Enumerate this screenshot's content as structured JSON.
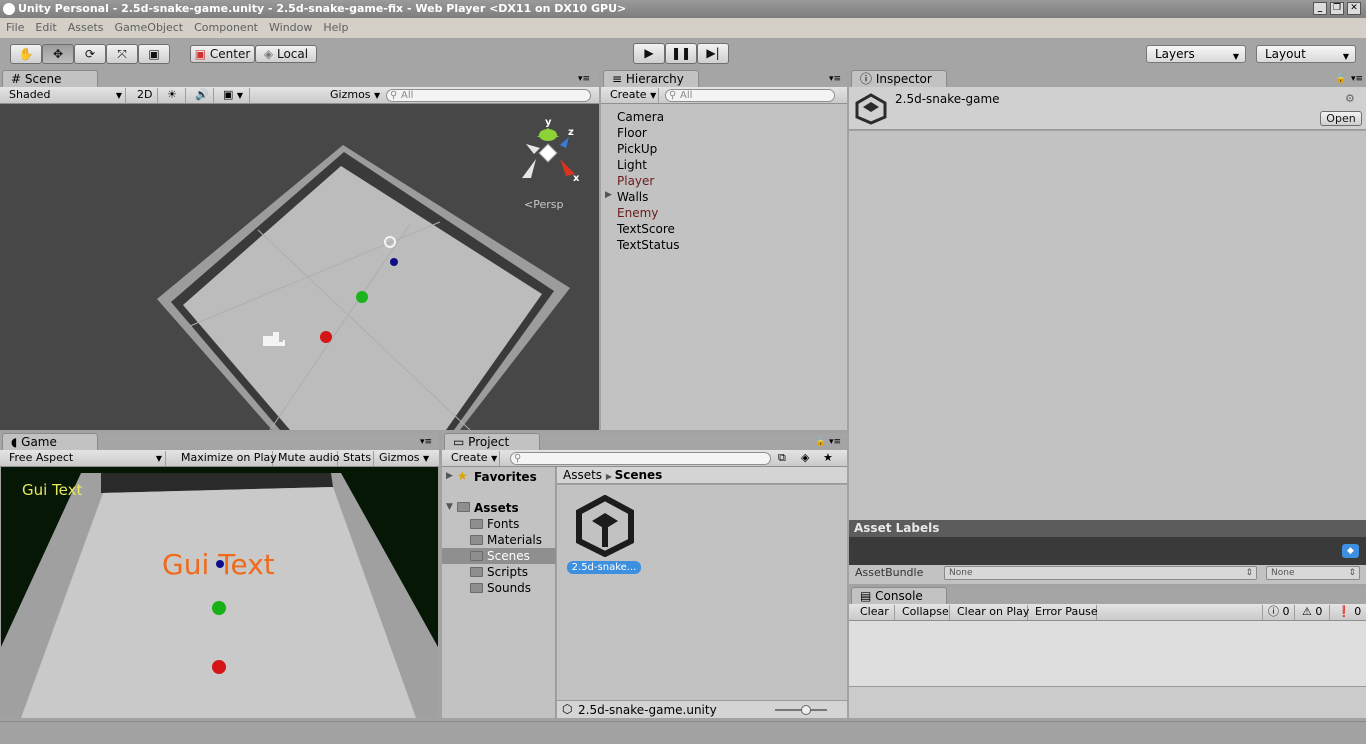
{
  "window": {
    "title": "Unity Personal - 2.5d-snake-game.unity - 2.5d-snake-game-fix - Web Player <DX11 on DX10 GPU>"
  },
  "menu": [
    "File",
    "Edit",
    "Assets",
    "GameObject",
    "Component",
    "Window",
    "Help"
  ],
  "toolbar": {
    "center": "Center",
    "local": "Local",
    "layers": "Layers",
    "layout": "Layout"
  },
  "scene": {
    "tab": "Scene",
    "shading": "Shaded",
    "mode2d": "2D",
    "gizmos": "Gizmos",
    "search": "All",
    "persp": "Persp",
    "axis_y": "y",
    "axis_z": "z",
    "axis_x": "x"
  },
  "hierarchy": {
    "tab": "Hierarchy",
    "create": "Create",
    "search": "All",
    "items": [
      {
        "name": "Camera",
        "color": "#000000"
      },
      {
        "name": "Floor",
        "color": "#000000"
      },
      {
        "name": "PickUp",
        "color": "#000000"
      },
      {
        "name": "Light",
        "color": "#000000"
      },
      {
        "name": "Player",
        "color": "#6b1a1a"
      },
      {
        "name": "Walls",
        "color": "#000000"
      },
      {
        "name": "Enemy",
        "color": "#6b1a1a"
      },
      {
        "name": "TextScore",
        "color": "#000000"
      },
      {
        "name": "TextStatus",
        "color": "#000000"
      }
    ]
  },
  "inspector": {
    "tab": "Inspector",
    "asset_name": "2.5d-snake-game",
    "open": "Open",
    "asset_labels": "Asset Labels",
    "asset_bundle": "AssetBundle",
    "bundle_value": "None",
    "variant_value": "None"
  },
  "game": {
    "tab": "Game",
    "aspect": "Free Aspect",
    "maximize": "Maximize on Play",
    "mute": "Mute audio",
    "stats": "Stats",
    "gizmos": "Gizmos",
    "gui_small": "Gui Text",
    "gui_big": "Gui Text"
  },
  "project": {
    "tab": "Project",
    "create": "Create",
    "favorites": "Favorites",
    "assets": "Assets",
    "folders": [
      "Fonts",
      "Materials",
      "Scenes",
      "Scripts",
      "Sounds"
    ],
    "selected_folder": "Scenes",
    "breadcrumb_root": "Assets",
    "breadcrumb_leaf": "Scenes",
    "item_label": "2.5d-snake...",
    "footer_path": "2.5d-snake-game.unity"
  },
  "console": {
    "tab": "Console",
    "clear": "Clear",
    "collapse": "Collapse",
    "clear_on_play": "Clear on Play",
    "error_pause": "Error Pause",
    "count_info": "0",
    "count_warn": "0",
    "count_error": "0"
  },
  "colors": {
    "accent": "#3d8fe0",
    "gui_big": "#f06a1a",
    "gui_small": "#e8e85a",
    "player": "#6b1a1a"
  }
}
